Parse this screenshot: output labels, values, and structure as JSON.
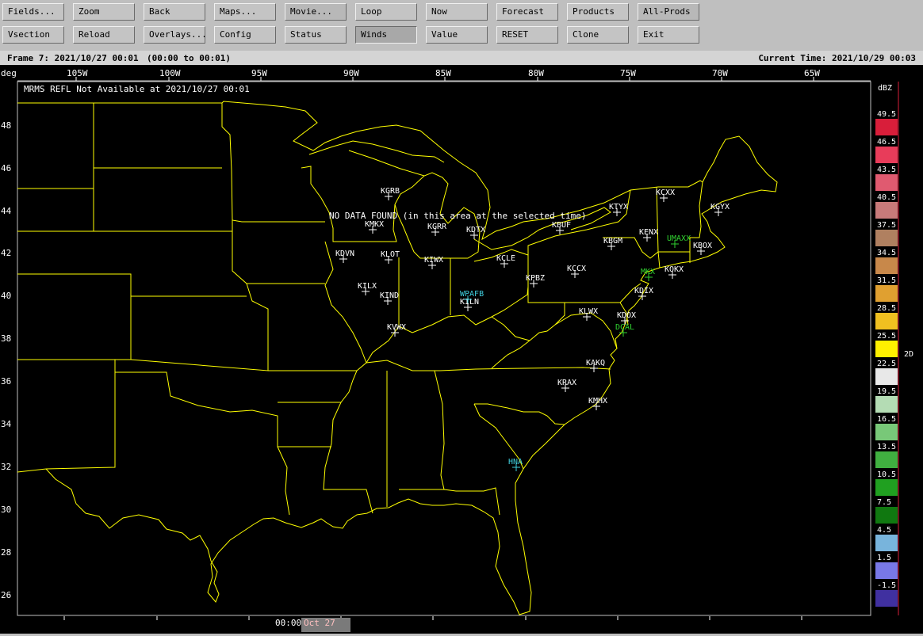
{
  "toolbar": {
    "row1": [
      {
        "label": "Fields...",
        "state": "normal"
      },
      {
        "label": "Zoom",
        "state": "normal"
      },
      {
        "label": "Back",
        "state": "normal"
      },
      {
        "label": "Maps...",
        "state": "normal"
      },
      {
        "label": "Movie...",
        "state": "active"
      },
      {
        "label": "Loop",
        "state": "normal"
      },
      {
        "label": "Now",
        "state": "normal"
      },
      {
        "label": "Forecast",
        "state": "normal"
      },
      {
        "label": "Products",
        "state": "normal"
      },
      {
        "label": "All-Prods",
        "state": "active"
      }
    ],
    "row2": [
      {
        "label": "Vsection",
        "state": "normal"
      },
      {
        "label": "Reload",
        "state": "normal"
      },
      {
        "label": "Overlays...",
        "state": "normal"
      },
      {
        "label": "Config",
        "state": "normal"
      },
      {
        "label": "Status",
        "state": "normal"
      },
      {
        "label": "Winds",
        "state": "pressed"
      },
      {
        "label": "Value",
        "state": "normal"
      },
      {
        "label": "RESET",
        "state": "normal"
      },
      {
        "label": "Clone",
        "state": "normal"
      },
      {
        "label": "Exit",
        "state": "normal"
      }
    ]
  },
  "status": {
    "frame": "Frame 7: 2021/10/27 00:01",
    "range": "(00:00 to 00:01)",
    "current_time": "Current Time: 2021/10/29 00:03"
  },
  "map": {
    "deg_label": "deg",
    "lon_labels": [
      "105W",
      "100W",
      "95W",
      "90W",
      "85W",
      "80W",
      "75W",
      "70W",
      "65W"
    ],
    "lat_labels": [
      "48",
      "46",
      "44",
      "42",
      "40",
      "38",
      "36",
      "34",
      "32",
      "30",
      "28",
      "26"
    ],
    "message_top": "MRMS REFL Not Available at 2021/10/27 00:01",
    "message_center": "NO DATA FOUND (in this area at the selected time)",
    "stations_white": [
      "KGRB",
      "KMKX",
      "KGRR",
      "KDTX",
      "KBUF",
      "KTYX",
      "KCXX",
      "KGYX",
      "KDVN",
      "KLOT",
      "KIWX",
      "KCLE",
      "KBGM",
      "KENX",
      "KBOX",
      "KILX",
      "KIND",
      "KPBZ",
      "KCCX",
      "KOKX",
      "KILN",
      "KDIX",
      "KLWX",
      "KDOX",
      "KVWX",
      "KAKQ",
      "KRAX",
      "KMHX"
    ],
    "stations_green": [
      "UMAXX",
      "MKX",
      "DCAL"
    ],
    "stations_cyan": [
      "WPAFB",
      "HNA"
    ],
    "line_color": "#ffff00"
  },
  "legend": {
    "unit": "dBZ",
    "labels": [
      "49.5",
      "46.5",
      "43.5",
      "40.5",
      "37.5",
      "34.5",
      "31.5",
      "28.5",
      "25.5",
      "22.5",
      "19.5",
      "16.5",
      "13.5",
      "10.5",
      "7.5",
      "4.5",
      "1.5",
      "-1.5"
    ],
    "colors": [
      "#d81e3a",
      "#e83c5a",
      "#e05a70",
      "#c87a7a",
      "#b08060",
      "#c8884a",
      "#e0a030",
      "#f0c020",
      "#fff000",
      "#e8e8e8",
      "#b4dcb4",
      "#78c878",
      "#40b040",
      "#20a020",
      "#107810",
      "#78b4dc",
      "#7878e8",
      "#4030a0",
      "#6a1aa0"
    ],
    "mode_label": "2D"
  },
  "timeline": {
    "time": "00:00",
    "date": "Oct 27"
  }
}
